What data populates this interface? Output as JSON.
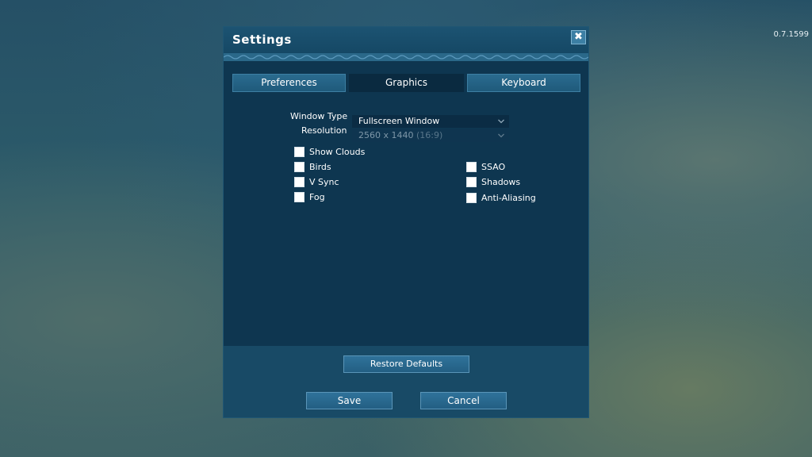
{
  "version": "0.7.1599",
  "dialog": {
    "title": "Settings",
    "close_glyph": "✖"
  },
  "tabs": [
    {
      "label": "Preferences",
      "active": false
    },
    {
      "label": "Graphics",
      "active": true
    },
    {
      "label": "Keyboard",
      "active": false
    }
  ],
  "graphics": {
    "window_type_label": "Window Type",
    "resolution_label": "Resolution",
    "window_type_value": "Fullscreen Window",
    "resolution_value": "2560 x 1440",
    "resolution_aspect": "(16:9)",
    "checkboxes_left": [
      {
        "label": "Show Clouds",
        "checked": false
      },
      {
        "label": "Birds",
        "checked": false
      },
      {
        "label": "V Sync",
        "checked": false
      },
      {
        "label": "Fog",
        "checked": false
      }
    ],
    "checkboxes_right": [
      {
        "label": "SSAO",
        "checked": false
      },
      {
        "label": "Shadows",
        "checked": false
      },
      {
        "label": "Anti-Aliasing",
        "checked": false
      }
    ]
  },
  "footer": {
    "restore_label": "Restore Defaults",
    "save_label": "Save",
    "cancel_label": "Cancel"
  },
  "icons": {
    "close": "close-icon",
    "dropdown": "chevron-down-icon"
  }
}
